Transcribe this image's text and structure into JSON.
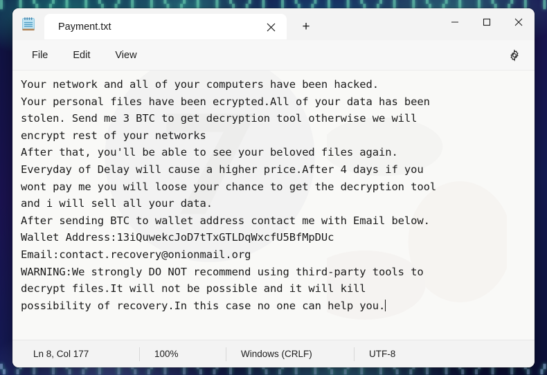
{
  "window": {
    "app_icon": "notepad-icon",
    "tab": {
      "title": "Payment.txt",
      "close_icon": "close-icon"
    },
    "new_tab_label": "+",
    "caption": {
      "minimize_icon": "minimize-icon",
      "maximize_icon": "maximize-icon",
      "close_icon": "close-icon"
    }
  },
  "menubar": {
    "items": [
      {
        "label": "File"
      },
      {
        "label": "Edit"
      },
      {
        "label": "View"
      }
    ],
    "settings_icon": "gear-icon"
  },
  "editor": {
    "lines": [
      "Your network and all of your computers have been hacked.",
      "Your personal files have been ecrypted.All of your data has been",
      "stolen. Send me 3 BTC to get decryption tool otherwise we will",
      "encrypt rest of your networks",
      "After that, you'll be able to see your beloved files again.",
      "Everyday of Delay will cause a higher price.After 4 days if you",
      "wont pay me you will loose your chance to get the decryption tool",
      "and i will sell all your data.",
      "After sending BTC to wallet address contact me with Email below.",
      "Wallet Address:13iQuwekcJoD7tTxGTLDqWxcfU5BfMpDUc",
      "Email:contact.recovery@onionmail.org",
      "WARNING:We strongly DO NOT recommend using third-party tools to",
      "decrypt files.It will not be possible and it will kill",
      "possibility of recovery.In this case no one can help you."
    ],
    "wallet_address": "13iQuwekcJoD7tTxGTLDqWxcfU5BfMpDUc",
    "email": "contact.recovery@onionmail.org",
    "ransom_amount": "3 BTC",
    "deadline_days": "4"
  },
  "statusbar": {
    "position": "Ln 8, Col 177",
    "zoom": "100%",
    "line_ending": "Windows (CRLF)",
    "encoding": "UTF-8"
  },
  "desktop": {
    "glyph_row_top": "▌ ▐ ▚ ▞ ▌ ▐ ▚ ▞ ▌ ▐ ▚ ▞ ▌ ▐ ▚ ▞ ▌ ▐ ▚ ▞ ▌ ▐ ▚ ▞ ▌ ▐ ▚ ▞ ▌ ▐ ▚ ▞ ▌ ▐ ▚ ▞ ▌ ▐ ▚ ▞ ▌ ▐ ▚ ▞ ▌ ▐ ▚ ▞ ▌ ▐ ▚ ▞",
    "glyph_row_bottom": "▚ ▞ ▌ ▐ ▚ ▞ ▌ ▐ ▚ ▞ ▌ ▐ ▚ ▞ ▌ ▐ ▚ ▞ ▌ ▐ ▚ ▞ ▌ ▐ ▚ ▞ ▌ ▐ ▚ ▞ ▌ ▐ ▚ ▞ ▌ ▐ ▚ ▞ ▌ ▐ ▚ ▞ ▌ ▐ ▚ ▞ ▌ ▐"
  },
  "colors": {
    "window_chrome": "#f3f3f3",
    "editor_bg": "#f9f9f7",
    "text": "#1a1a1a",
    "desktop": "#151a46",
    "accent_icon": "#6cb8e0"
  }
}
